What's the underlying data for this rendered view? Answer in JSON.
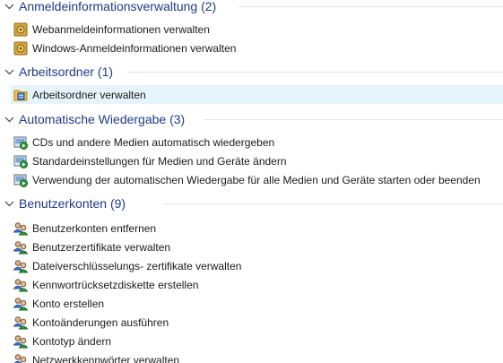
{
  "groups": [
    {
      "title": "Anmeldeinformationsverwaltung (2)",
      "icon": "credential-vault-icon",
      "items": [
        {
          "label": "Webanmeldeinformationen verwalten"
        },
        {
          "label": "Windows-Anmeldeinformationen verwalten"
        }
      ]
    },
    {
      "title": "Arbeitsordner (1)",
      "icon": "work-folders-icon",
      "items": [
        {
          "label": "Arbeitsordner verwalten",
          "selected": true
        }
      ]
    },
    {
      "title": "Automatische Wiedergabe (3)",
      "icon": "autoplay-icon",
      "items": [
        {
          "label": "CDs und andere Medien automatisch wiedergeben"
        },
        {
          "label": "Standardeinstellungen für Medien und Geräte ändern"
        },
        {
          "label": "Verwendung der automatischen Wiedergabe für alle Medien und Geräte starten oder beenden"
        }
      ]
    },
    {
      "title": "Benutzerkonten (9)",
      "icon": "user-accounts-icon",
      "items": [
        {
          "label": "Benutzerkonten entfernen"
        },
        {
          "label": "Benutzerzertifikate verwalten"
        },
        {
          "label": "Dateiverschlüsselungs- zertifikate verwalten"
        },
        {
          "label": "Kennwortrücksetzdiskette erstellen"
        },
        {
          "label": "Konto erstellen"
        },
        {
          "label": "Kontoänderungen ausführen"
        },
        {
          "label": "Kontotyp ändern"
        },
        {
          "label": "Netzwerkkennwörter verwalten"
        }
      ]
    }
  ],
  "colors": {
    "header_text": "#1e3b8a",
    "selection_bg": "#e5f3fb"
  }
}
